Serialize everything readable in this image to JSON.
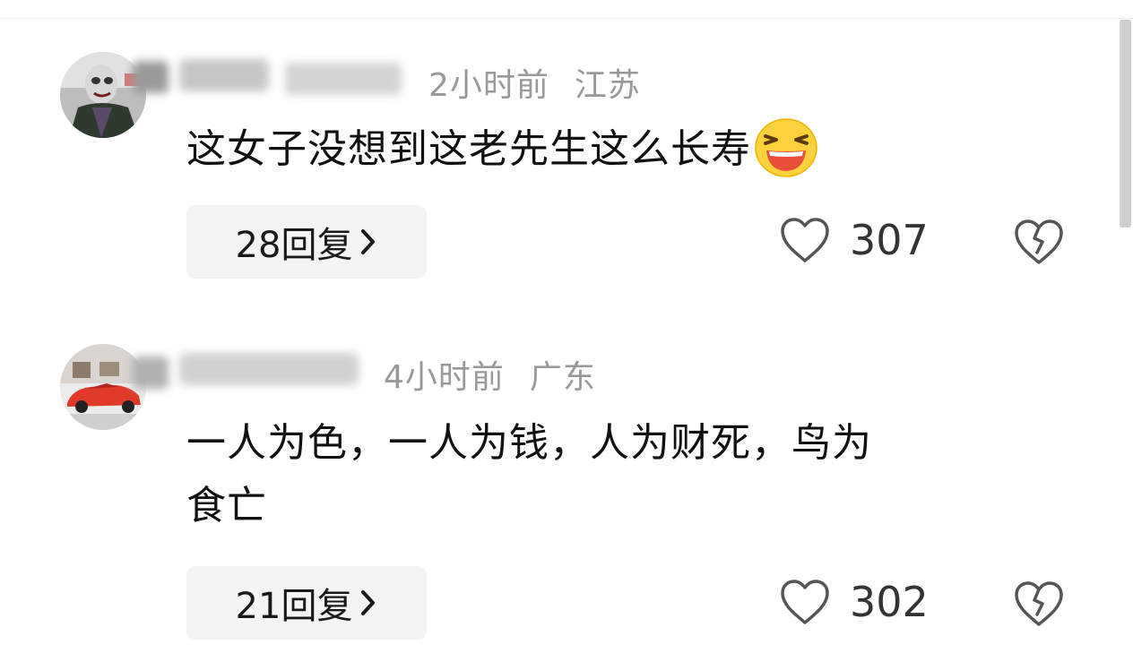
{
  "comments": [
    {
      "time": "2小时前",
      "location": "江苏",
      "text": "这女子没想到这老先生这么长寿",
      "emoji": "laughing-emoji",
      "reply_label": "28回复",
      "likes": "307"
    },
    {
      "time": "4小时前",
      "location": "广东",
      "text_line1": "一人为色，一人为钱，人为财死，鸟为",
      "text_line2": "食亡",
      "reply_label": "21回复",
      "likes": "302"
    }
  ],
  "icons": {
    "like": "heart-outline-icon",
    "dislike": "broken-heart-icon",
    "chevron": "chevron-right-icon"
  },
  "colors": {
    "meta": "#999999",
    "text": "#111111",
    "button_bg": "#f4f4f5"
  }
}
